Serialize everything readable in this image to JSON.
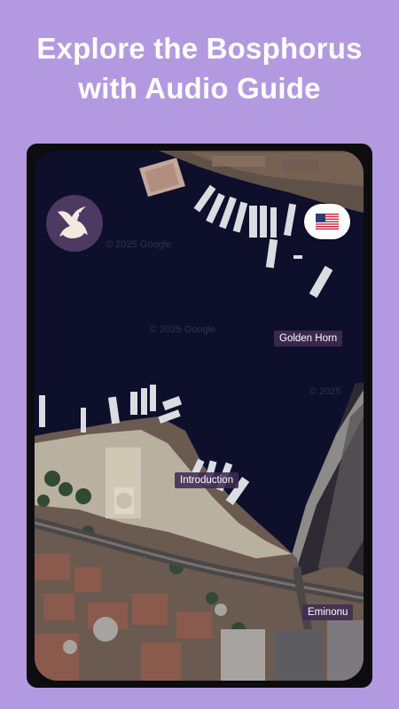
{
  "headline": {
    "line1": "Explore the Bosphorus",
    "line2": "with Audio Guide"
  },
  "map": {
    "attribution_1": "© 2025 Google",
    "attribution_2": "© 2025 Google",
    "attribution_3": "© 2025",
    "google_mark": "Google",
    "pois": [
      {
        "label": "Golden Horn"
      },
      {
        "label": "Introduction"
      },
      {
        "label": "Eminonu"
      }
    ]
  },
  "controls": {
    "logo_icon": "seagull-logo-icon",
    "language_icon": "us-flag-icon"
  },
  "colors": {
    "background": "#b39ae0",
    "water": "#0d0e2a",
    "logo_bg": "#4c3a63",
    "poi_bg": "#402c52"
  }
}
